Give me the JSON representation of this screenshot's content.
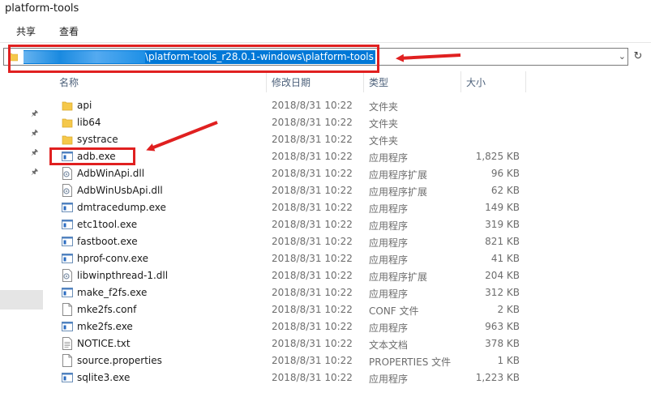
{
  "window": {
    "title": "platform-tools"
  },
  "ribbon": {
    "tabs": [
      "共享",
      "查看"
    ]
  },
  "address": {
    "path": "\\platform-tools_r28.0.1-windows\\platform-tools"
  },
  "columns": {
    "name": "名称",
    "date": "修改日期",
    "type": "类型",
    "size": "大小"
  },
  "files": [
    {
      "name": "api",
      "date": "2018/8/31 10:22",
      "type": "文件夹",
      "size": "",
      "icon": "folder-icon"
    },
    {
      "name": "lib64",
      "date": "2018/8/31 10:22",
      "type": "文件夹",
      "size": "",
      "icon": "folder-icon"
    },
    {
      "name": "systrace",
      "date": "2018/8/31 10:22",
      "type": "文件夹",
      "size": "",
      "icon": "folder-icon"
    },
    {
      "name": "adb.exe",
      "date": "2018/8/31 10:22",
      "type": "应用程序",
      "size": "1,825 KB",
      "icon": "exe-icon"
    },
    {
      "name": "AdbWinApi.dll",
      "date": "2018/8/31 10:22",
      "type": "应用程序扩展",
      "size": "96 KB",
      "icon": "dll-icon"
    },
    {
      "name": "AdbWinUsbApi.dll",
      "date": "2018/8/31 10:22",
      "type": "应用程序扩展",
      "size": "62 KB",
      "icon": "dll-icon"
    },
    {
      "name": "dmtracedump.exe",
      "date": "2018/8/31 10:22",
      "type": "应用程序",
      "size": "149 KB",
      "icon": "exe-icon"
    },
    {
      "name": "etc1tool.exe",
      "date": "2018/8/31 10:22",
      "type": "应用程序",
      "size": "319 KB",
      "icon": "exe-icon"
    },
    {
      "name": "fastboot.exe",
      "date": "2018/8/31 10:22",
      "type": "应用程序",
      "size": "821 KB",
      "icon": "exe-icon"
    },
    {
      "name": "hprof-conv.exe",
      "date": "2018/8/31 10:22",
      "type": "应用程序",
      "size": "41 KB",
      "icon": "exe-icon"
    },
    {
      "name": "libwinpthread-1.dll",
      "date": "2018/8/31 10:22",
      "type": "应用程序扩展",
      "size": "204 KB",
      "icon": "dll-icon"
    },
    {
      "name": "make_f2fs.exe",
      "date": "2018/8/31 10:22",
      "type": "应用程序",
      "size": "312 KB",
      "icon": "exe-icon"
    },
    {
      "name": "mke2fs.conf",
      "date": "2018/8/31 10:22",
      "type": "CONF 文件",
      "size": "2 KB",
      "icon": "file-icon"
    },
    {
      "name": "mke2fs.exe",
      "date": "2018/8/31 10:22",
      "type": "应用程序",
      "size": "963 KB",
      "icon": "exe-icon"
    },
    {
      "name": "NOTICE.txt",
      "date": "2018/8/31 10:22",
      "type": "文本文档",
      "size": "378 KB",
      "icon": "text-file-icon"
    },
    {
      "name": "source.properties",
      "date": "2018/8/31 10:22",
      "type": "PROPERTIES 文件",
      "size": "1 KB",
      "icon": "file-icon"
    },
    {
      "name": "sqlite3.exe",
      "date": "2018/8/31 10:22",
      "type": "应用程序",
      "size": "1,223 KB",
      "icon": "exe-icon"
    }
  ],
  "colors": {
    "highlight": "#0078d7",
    "annotation": "#e02020",
    "folder": "#f5c84a"
  }
}
